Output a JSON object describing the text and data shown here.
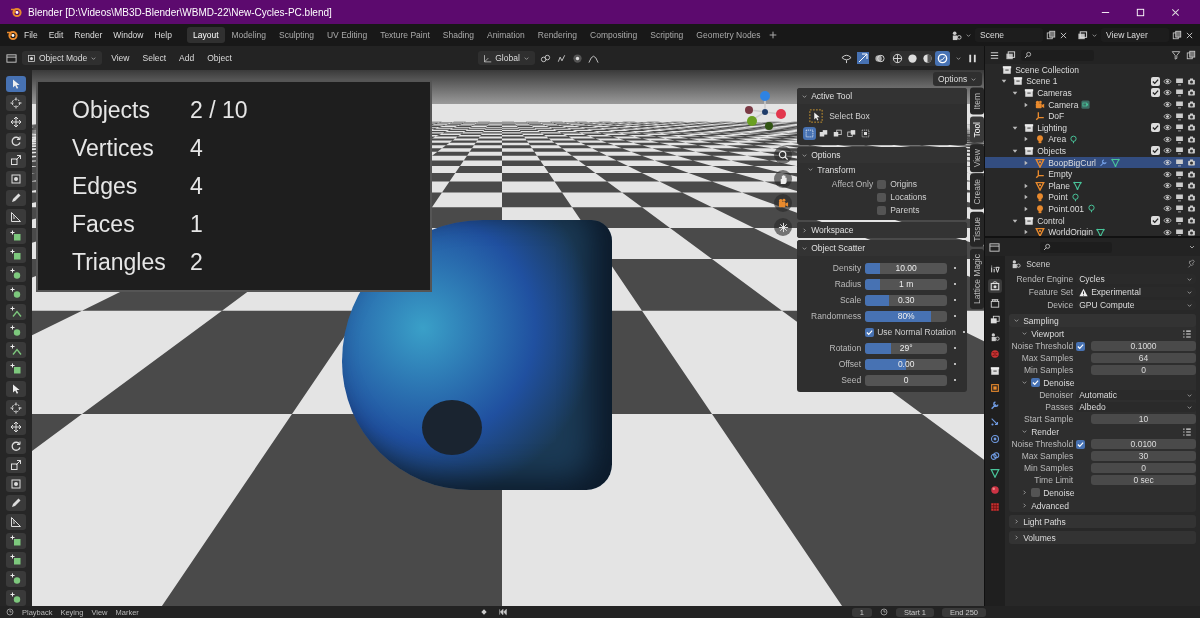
{
  "window": {
    "title": "Blender [D:\\Videos\\MB3D-Blender\\WBMD-22\\New-Cycles-PC.blend]"
  },
  "menus": [
    "File",
    "Edit",
    "Render",
    "Window",
    "Help"
  ],
  "workspaces": [
    {
      "label": "Layout",
      "selected": true
    },
    {
      "label": "Modeling",
      "selected": false
    },
    {
      "label": "Sculpting",
      "selected": false
    },
    {
      "label": "UV Editing",
      "selected": false
    },
    {
      "label": "Texture Paint",
      "selected": false
    },
    {
      "label": "Shading",
      "selected": false
    },
    {
      "label": "Animation",
      "selected": false
    },
    {
      "label": "Rendering",
      "selected": false
    },
    {
      "label": "Compositing",
      "selected": false
    },
    {
      "label": "Scripting",
      "selected": false
    },
    {
      "label": "Geometry Nodes",
      "selected": false
    }
  ],
  "scene": "Scene",
  "view_layer": "View Layer",
  "viewport_header": {
    "mode": "Object Mode",
    "menus": [
      "View",
      "Select",
      "Add",
      "Object"
    ],
    "orientation": "Global",
    "options": "Options",
    "shading": [
      {
        "selected": false
      },
      {
        "selected": false
      },
      {
        "selected": false
      },
      {
        "selected": true
      }
    ]
  },
  "tools": [
    {
      "selected": true
    },
    {
      "selected": false
    },
    {
      "selected": false
    },
    {
      "selected": false
    },
    {
      "selected": false
    },
    {
      "selected": false
    },
    {
      "selected": false
    },
    {
      "selected": false
    },
    {
      "selected": false
    },
    {
      "selected": false
    },
    {
      "selected": false
    },
    {
      "selected": false
    },
    {
      "selected": false
    },
    {
      "selected": false
    },
    {
      "selected": false
    },
    {
      "selected": false
    },
    {
      "selected": false
    },
    {
      "selected": false
    },
    {
      "selected": false
    },
    {
      "selected": false
    },
    {
      "selected": false
    },
    {
      "selected": false
    },
    {
      "selected": false
    },
    {
      "selected": false
    },
    {
      "selected": false
    },
    {
      "selected": false
    },
    {
      "selected": false
    },
    {
      "selected": false
    }
  ],
  "stats": [
    {
      "label": "Objects",
      "value": "2 / 10"
    },
    {
      "label": "Vertices",
      "value": "4"
    },
    {
      "label": "Edges",
      "value": "4"
    },
    {
      "label": "Faces",
      "value": "1"
    },
    {
      "label": "Triangles",
      "value": "2"
    }
  ],
  "sidebar_tabs": [
    {
      "label": "Item",
      "selected": false
    },
    {
      "label": "Tool",
      "selected": true
    },
    {
      "label": "View",
      "selected": false
    },
    {
      "label": "Create",
      "selected": false
    },
    {
      "label": "Tissue",
      "selected": false
    },
    {
      "label": "Lattice Magic",
      "selected": false
    }
  ],
  "active_tool": {
    "title": "Active Tool",
    "tool": "Select Box",
    "modes": [
      {
        "selected": true
      },
      {
        "selected": false
      },
      {
        "selected": false
      },
      {
        "selected": false
      },
      {
        "selected": false
      }
    ]
  },
  "options": {
    "title": "Options",
    "transform": "Transform",
    "affect_only": "Affect Only",
    "checks": [
      {
        "label": "Origins",
        "checked": false
      },
      {
        "label": "Locations",
        "checked": false
      },
      {
        "label": "Parents",
        "checked": false
      }
    ]
  },
  "workspace_panel": {
    "title": "Workspace",
    "expanded": false
  },
  "object_scatter": {
    "title": "Object Scatter",
    "fields": [
      {
        "kind": "slider",
        "label": "Density",
        "value": "10.00",
        "level": 0.18
      },
      {
        "kind": "slider",
        "label": "Radius",
        "value": "1 m",
        "level": 0.18
      },
      {
        "kind": "slider",
        "label": "Scale",
        "value": "0.30",
        "level": 0.29
      },
      {
        "kind": "slider",
        "label": "Randomness",
        "value": "80%",
        "level": 0.8
      },
      {
        "kind": "checkbox",
        "label": "Use Normal Rotation",
        "checked": true
      },
      {
        "kind": "slider",
        "label": "Rotation",
        "value": "29°",
        "level": 0.31
      },
      {
        "kind": "slider",
        "label": "Offset",
        "value": "0.00",
        "level": 0.5
      },
      {
        "kind": "slider",
        "label": "Seed",
        "value": "0",
        "level": 0
      }
    ]
  },
  "outliner": {
    "items": [
      {
        "name": "Scene Collection",
        "kind": "root",
        "children": [
          {
            "name": "Scene 1",
            "kind": "collection",
            "expanded": true,
            "checked": true,
            "selected": false,
            "children": [
              {
                "name": "Cameras",
                "kind": "collection",
                "expanded": true,
                "checked": true,
                "selected": false,
                "children": [
                  {
                    "name": "Camera",
                    "kind": "camera",
                    "expanded": false,
                    "selected": false
                  },
                  {
                    "name": "DoF",
                    "kind": "empty",
                    "selected": false
                  }
                ]
              },
              {
                "name": "Lighting",
                "kind": "collection",
                "expanded": true,
                "checked": true,
                "selected": false,
                "children": [
                  {
                    "name": "Area",
                    "kind": "light",
                    "expanded": false,
                    "selected": false
                  }
                ]
              },
              {
                "name": "Objects",
                "kind": "collection",
                "expanded": true,
                "checked": true,
                "selected": false,
                "children": [
                  {
                    "name": "BoopBigCurl",
                    "kind": "mesh",
                    "expanded": false,
                    "modifier": true,
                    "selected": true
                  },
                  {
                    "name": "Empty",
                    "kind": "empty",
                    "selected": false
                  },
                  {
                    "name": "Plane",
                    "kind": "mesh",
                    "expanded": false,
                    "selected": false
                  },
                  {
                    "name": "Point",
                    "kind": "light",
                    "expanded": false,
                    "selected": false
                  },
                  {
                    "name": "Point.001",
                    "kind": "light",
                    "expanded": false,
                    "selected": false
                  }
                ]
              },
              {
                "name": "Control",
                "kind": "collection",
                "expanded": true,
                "checked": true,
                "selected": false,
                "children": [
                  {
                    "name": "WorldOrigin",
                    "kind": "mesh",
                    "expanded": false,
                    "selected": false
                  }
                ]
              }
            ]
          }
        ]
      }
    ]
  },
  "property_tabs": [
    {
      "selected": false
    },
    {
      "selected": true
    },
    {
      "selected": false
    },
    {
      "selected": false
    },
    {
      "selected": false
    },
    {
      "selected": false
    },
    {
      "selected": false
    },
    {
      "selected": false
    },
    {
      "selected": false
    },
    {
      "selected": false
    },
    {
      "selected": false
    },
    {
      "selected": false
    },
    {
      "selected": false
    },
    {
      "selected": false
    },
    {
      "selected": false
    }
  ],
  "properties": {
    "context": "Scene",
    "fields": [
      {
        "kind": "dropdown",
        "label": "Render Engine",
        "value": "Cycles"
      },
      {
        "kind": "dropdown",
        "label": "Feature Set",
        "value": "Experimental",
        "warning": true
      },
      {
        "kind": "dropdown",
        "label": "Device",
        "value": "GPU Compute"
      }
    ],
    "panels": [
      {
        "title": "Sampling",
        "expanded": true,
        "rows": [
          {
            "kind": "subpanel-presets",
            "title": "Viewport",
            "expanded": true
          },
          {
            "kind": "check-number",
            "label": "Noise Threshold",
            "checked": true,
            "value": "0.1000"
          },
          {
            "kind": "number",
            "label": "Max Samples",
            "value": "64"
          },
          {
            "kind": "number",
            "label": "Min Samples",
            "value": "0"
          },
          {
            "kind": "subpanel",
            "title": "Denoise",
            "expanded": true,
            "checked": true
          },
          {
            "kind": "dropdown",
            "label": "Denoiser",
            "value": "Automatic"
          },
          {
            "kind": "dropdown",
            "label": "Passes",
            "value": "Albedo"
          },
          {
            "kind": "number",
            "label": "Start Sample",
            "value": "10"
          },
          {
            "kind": "subpanel-presets",
            "title": "Render",
            "expanded": true
          },
          {
            "kind": "check-number",
            "label": "Noise Threshold",
            "checked": true,
            "value": "0.0100"
          },
          {
            "kind": "number",
            "label": "Max Samples",
            "value": "30"
          },
          {
            "kind": "number",
            "label": "Min Samples",
            "value": "0"
          },
          {
            "kind": "number",
            "label": "Time Limit",
            "value": "0 sec"
          },
          {
            "kind": "subpanel",
            "title": "Denoise",
            "expanded": false,
            "checked": false
          },
          {
            "kind": "subpanel",
            "title": "Advanced",
            "expanded": false
          }
        ]
      },
      {
        "title": "Light Paths",
        "expanded": false
      },
      {
        "title": "Volumes",
        "expanded": false
      }
    ]
  },
  "timeline": {
    "menus": [
      "Playback",
      "Keying",
      "View",
      "Marker"
    ],
    "frame": "1",
    "start_label": "Start",
    "start": "1",
    "end_label": "End",
    "end": "250"
  }
}
